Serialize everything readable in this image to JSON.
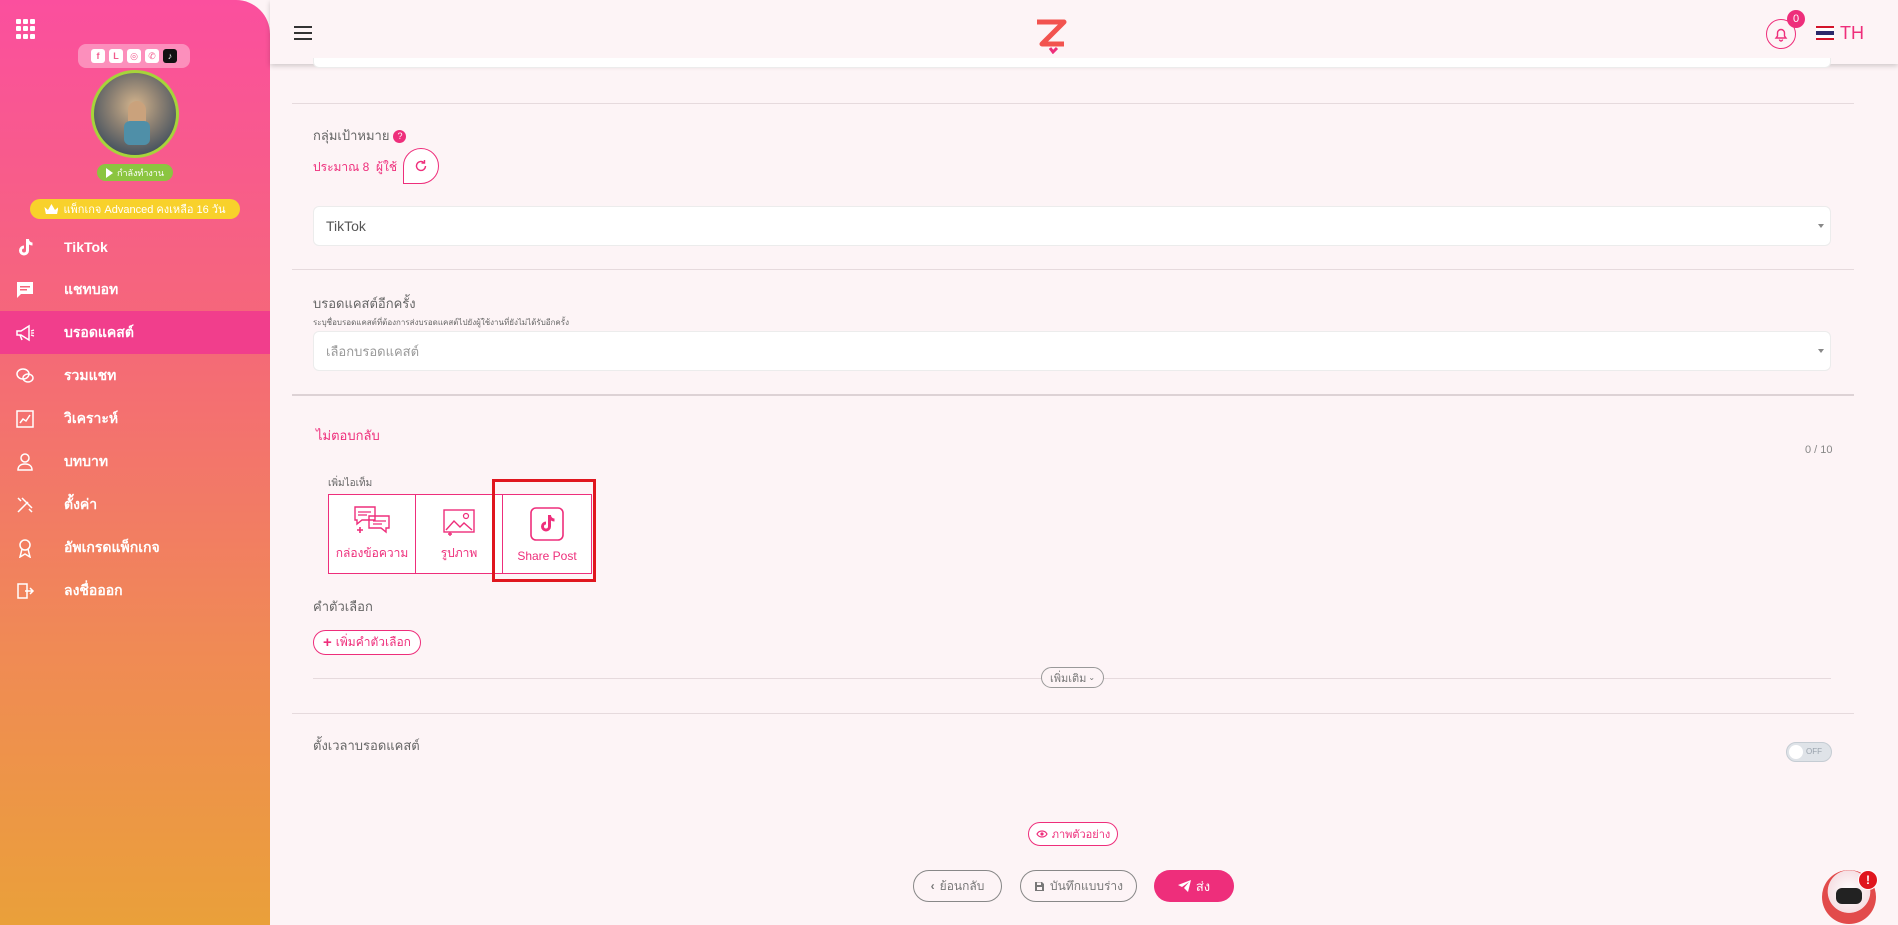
{
  "sidebar": {
    "social_icons": [
      "facebook-icon",
      "line-icon",
      "instagram-icon",
      "whatsapp-icon",
      "tiktok-icon"
    ],
    "status_label": "กำลังทำงาน",
    "package_label": "แพ็กเกจ Advanced คงเหลือ 16 วัน",
    "items": [
      {
        "label": "TikTok",
        "icon": "tiktok-icon"
      },
      {
        "label": "แชทบอท",
        "icon": "chat-icon"
      },
      {
        "label": "บรอดแคสต์",
        "icon": "megaphone-icon",
        "active": true
      },
      {
        "label": "รวมแชท",
        "icon": "chats-icon"
      },
      {
        "label": "วิเคราะห์",
        "icon": "analytics-icon"
      },
      {
        "label": "บทบาท",
        "icon": "user-icon"
      },
      {
        "label": "ตั้งค่า",
        "icon": "settings-icon"
      },
      {
        "label": "อัพเกรดแพ็กเกจ",
        "icon": "award-icon"
      },
      {
        "label": "ลงชื่อออก",
        "icon": "logout-icon"
      }
    ]
  },
  "topbar": {
    "notification_count": "0",
    "language": "TH"
  },
  "target": {
    "title": "กลุ่มเป้าหมาย",
    "estimate_prefix": "ประมาณ 8",
    "estimate_unit": "ผู้ใช้",
    "platform_value": "TikTok"
  },
  "rebroadcast": {
    "title": "บรอดแคสต์อีกครั้ง",
    "hint": "ระบุชื่อบรอดแคสต์ที่ต้องการส่งบรอดแคสต์ไปยังผู้ใช้งานที่ยังไม่ได้รับอีกครั้ง",
    "placeholder": "เลือกบรอดแคสต์"
  },
  "no_reply": {
    "title": "ไม่ตอบกลับ",
    "counter": "0 / 10",
    "add_item_label": "เพิ่มไอเท็ม",
    "items": [
      {
        "label": "กล่องข้อความ",
        "icon": "message-box-icon"
      },
      {
        "label": "รูปภาพ",
        "icon": "image-icon"
      },
      {
        "label": "Share Post",
        "icon": "tiktok-icon"
      }
    ],
    "options_label": "คำตัวเลือก",
    "add_option_label": "เพิ่มคำตัวเลือก",
    "more_label": "เพิ่มเติม"
  },
  "schedule": {
    "title": "ตั้งเวลาบรอดแคสต์",
    "toggle_label": "OFF"
  },
  "actions": {
    "preview_label": "ภาพตัวอย่าง",
    "back_label": "ย้อนกลับ",
    "draft_label": "บันทึกแบบร่าง",
    "send_label": "ส่ง"
  },
  "chatbot_badge": "!",
  "colors": {
    "accent": "#ee2e7b",
    "highlight": "#e0161e",
    "active_nav": "#f13e8c"
  }
}
